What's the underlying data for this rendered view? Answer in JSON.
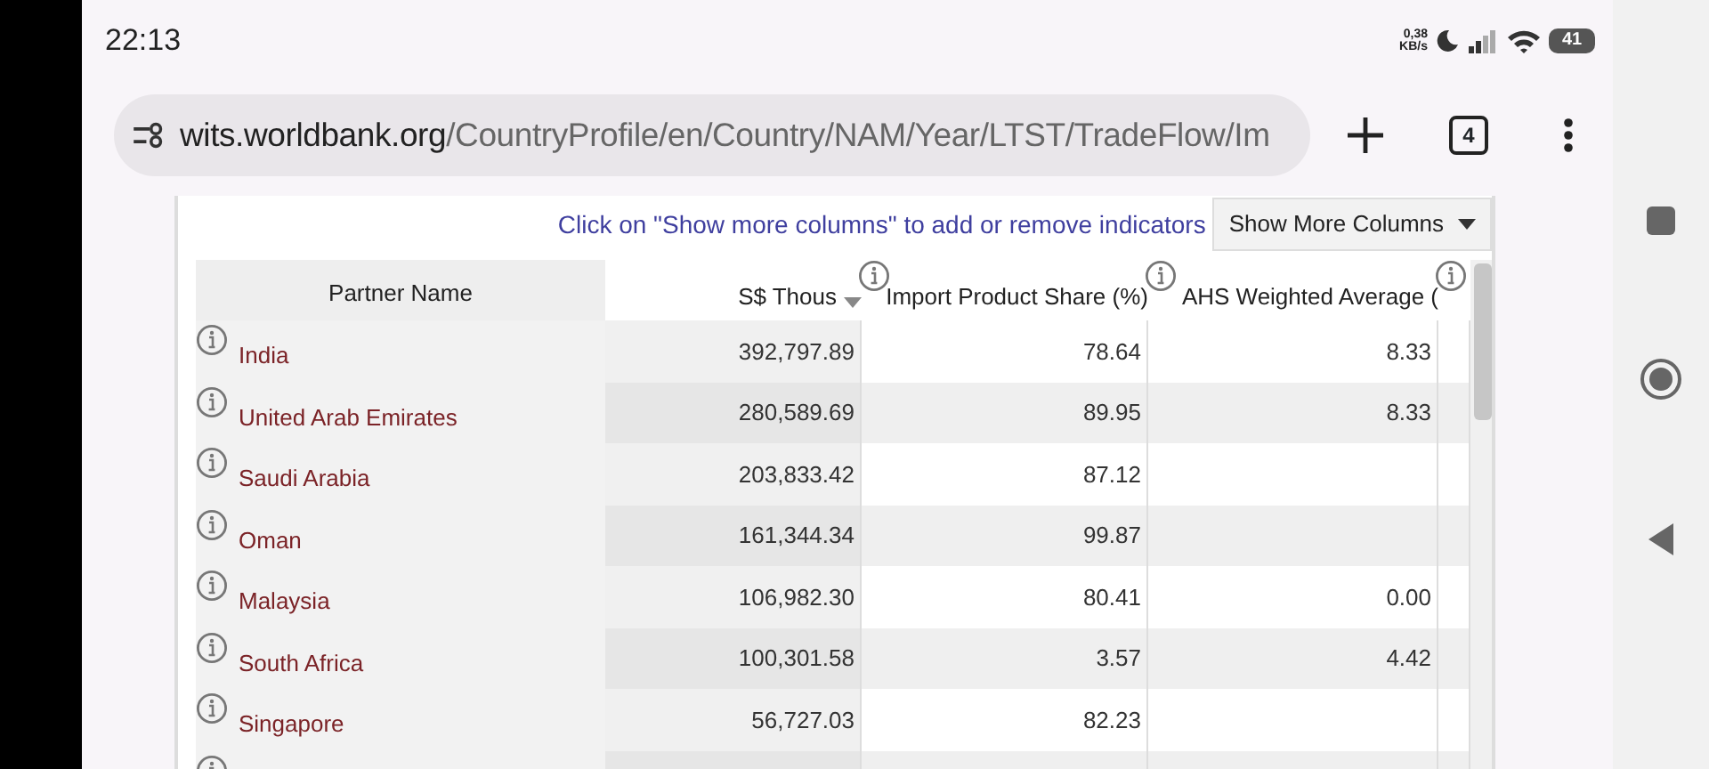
{
  "status_bar": {
    "time": "22:13",
    "net_speed": "0,38",
    "net_unit": "KB/s",
    "battery": "41"
  },
  "browser": {
    "url_host": "wits.worldbank.org",
    "url_path": "/CountryProfile/en/Country/NAM/Year/LTST/TradeFlow/Im",
    "tab_count": "4"
  },
  "table": {
    "hint": "Click on \"Show more columns\" to add or remove indicators",
    "show_more_button": "Show More Columns",
    "columns": [
      {
        "label": "Partner Name",
        "kind": "name",
        "sorted": false
      },
      {
        "label": "S$ Thous",
        "kind": "value",
        "sorted": true
      },
      {
        "label": "Import Product Share (%)",
        "kind": "value",
        "sorted": false
      },
      {
        "label": "AHS Weighted Average (",
        "kind": "value",
        "sorted": false
      }
    ],
    "rows": [
      {
        "partner": "India",
        "values": [
          "392,797.89",
          "78.64",
          "8.33"
        ]
      },
      {
        "partner": "United Arab Emirates",
        "values": [
          "280,589.69",
          "89.95",
          "8.33"
        ]
      },
      {
        "partner": "Saudi Arabia",
        "values": [
          "203,833.42",
          "87.12"
        ]
      },
      {
        "partner": "Oman",
        "values": [
          "161,344.34",
          "99.87"
        ]
      },
      {
        "partner": "Malaysia",
        "values": [
          "106,982.30",
          "80.41",
          "0.00"
        ]
      },
      {
        "partner": "South Africa",
        "values": [
          "100,301.58",
          "3.57",
          "4.42"
        ]
      },
      {
        "partner": "Singapore",
        "values": [
          "56,727.03",
          "82.23"
        ]
      }
    ],
    "partial_row": true
  }
}
